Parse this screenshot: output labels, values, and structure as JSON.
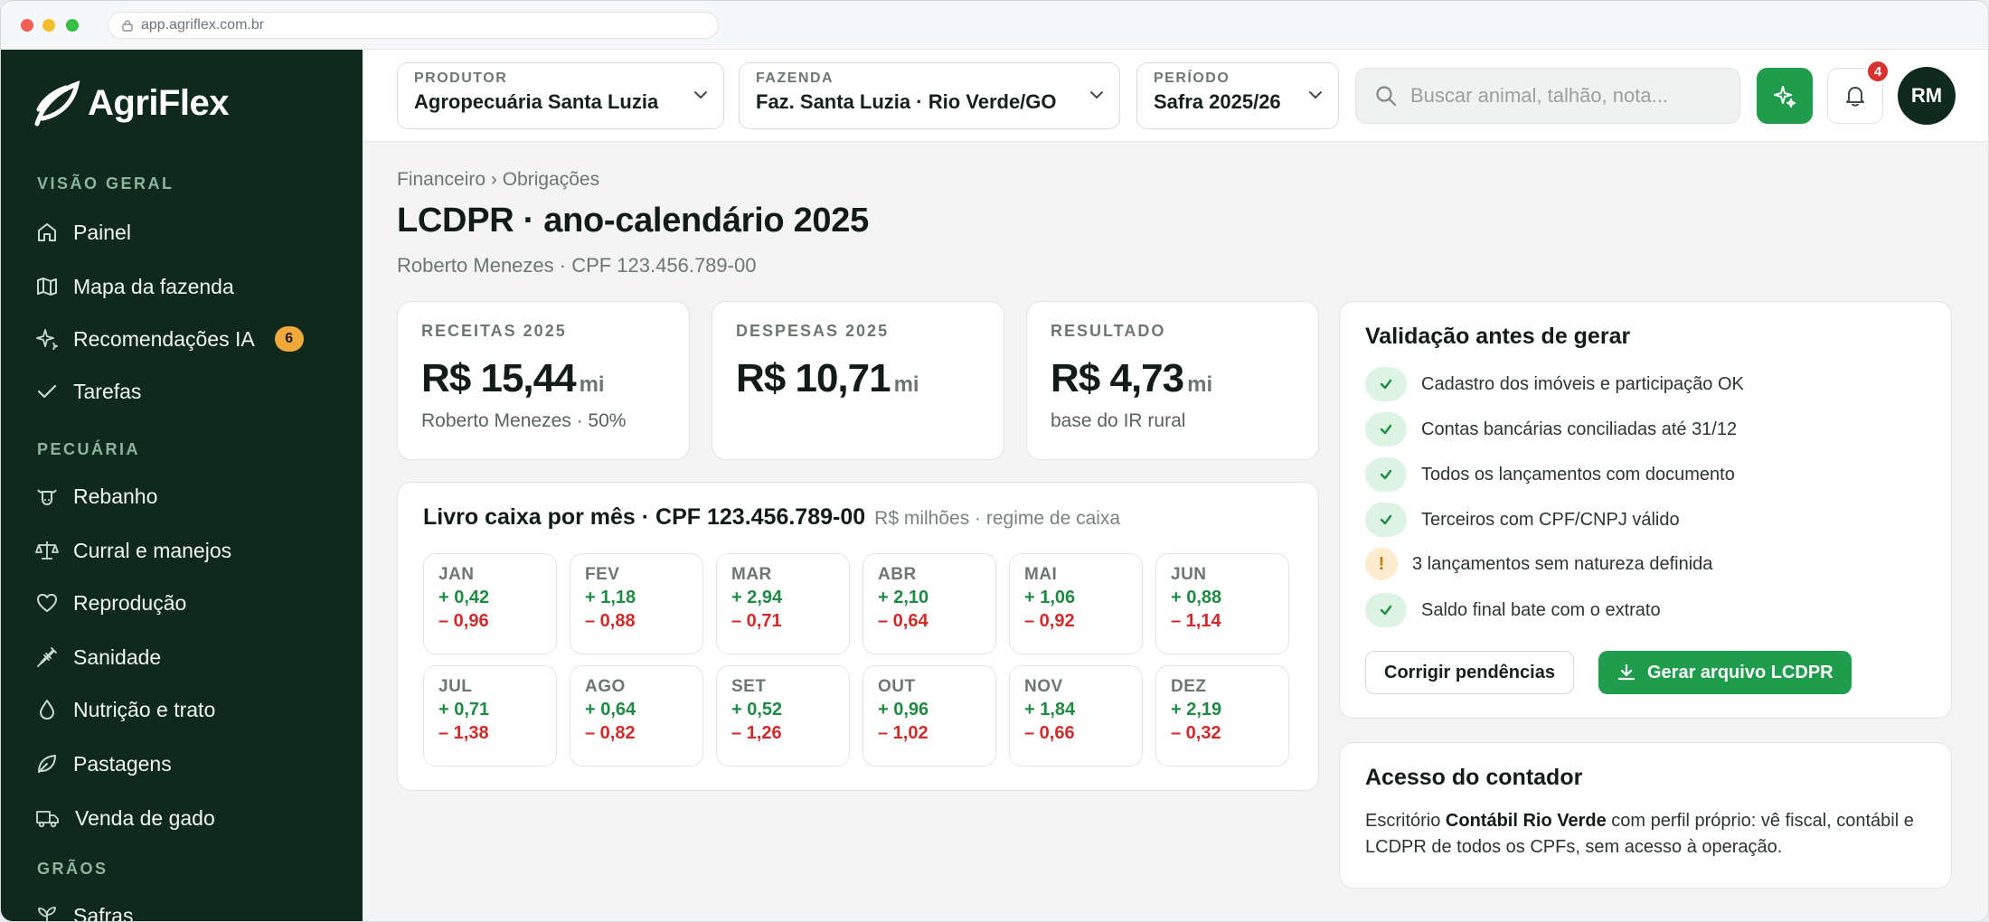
{
  "browser": {
    "url": "app.agriflex.com.br"
  },
  "brand": {
    "name": "AgriFlex"
  },
  "sidebar": {
    "sections": [
      {
        "label": "VISÃO GERAL"
      },
      {
        "label": "PECUÁRIA"
      },
      {
        "label": "GRÃOS"
      }
    ],
    "items": [
      {
        "label": "Painel",
        "icon": "home-icon"
      },
      {
        "label": "Mapa da fazenda",
        "icon": "map-icon"
      },
      {
        "label": "Recomendações IA",
        "icon": "sparkle-icon",
        "badge": "6"
      },
      {
        "label": "Tarefas",
        "icon": "check-icon"
      },
      {
        "label": "Rebanho",
        "icon": "cow-icon"
      },
      {
        "label": "Curral e manejos",
        "icon": "scale-icon"
      },
      {
        "label": "Reprodução",
        "icon": "heart-icon"
      },
      {
        "label": "Sanidade",
        "icon": "syringe-icon"
      },
      {
        "label": "Nutrição e trato",
        "icon": "drop-icon"
      },
      {
        "label": "Pastagens",
        "icon": "leaf-icon"
      },
      {
        "label": "Venda de gado",
        "icon": "truck-icon"
      },
      {
        "label": "Safras",
        "icon": "sprout-icon"
      }
    ]
  },
  "topbar": {
    "produtor": {
      "label": "PRODUTOR",
      "value": "Agropecuária Santa Luzia"
    },
    "fazenda": {
      "label": "FAZENDA",
      "value": "Faz. Santa Luzia · Rio Verde/GO"
    },
    "periodo": {
      "label": "PERÍODO",
      "value": "Safra 2025/26"
    },
    "search_placeholder": "Buscar animal, talhão, nota...",
    "notifications": "4",
    "avatar": "RM"
  },
  "page": {
    "breadcrumb": "Financeiro › Obrigações",
    "title": "LCDPR · ano-calendário 2025",
    "subtitle": "Roberto Menezes · CPF 123.456.789-00"
  },
  "kpis": [
    {
      "label": "RECEITAS 2025",
      "value": "R$ 15,44",
      "unit": "mi",
      "note": "Roberto Menezes · 50%"
    },
    {
      "label": "DESPESAS 2025",
      "value": "R$ 10,71",
      "unit": "mi",
      "note": ""
    },
    {
      "label": "RESULTADO",
      "value": "R$ 4,73",
      "unit": "mi",
      "note": "base do IR rural"
    }
  ],
  "cashbook": {
    "title": "Livro caixa por mês · CPF 123.456.789-00",
    "subtitle": "R$ milhões · regime de caixa",
    "months": [
      {
        "name": "JAN",
        "in": "+ 0,42",
        "out": "– 0,96"
      },
      {
        "name": "FEV",
        "in": "+ 1,18",
        "out": "– 0,88"
      },
      {
        "name": "MAR",
        "in": "+ 2,94",
        "out": "– 0,71"
      },
      {
        "name": "ABR",
        "in": "+ 2,10",
        "out": "– 0,64"
      },
      {
        "name": "MAI",
        "in": "+ 1,06",
        "out": "– 0,92"
      },
      {
        "name": "JUN",
        "in": "+ 0,88",
        "out": "– 1,14"
      },
      {
        "name": "JUL",
        "in": "+ 0,71",
        "out": "– 1,38"
      },
      {
        "name": "AGO",
        "in": "+ 0,64",
        "out": "– 0,82"
      },
      {
        "name": "SET",
        "in": "+ 0,52",
        "out": "– 1,26"
      },
      {
        "name": "OUT",
        "in": "+ 0,96",
        "out": "– 1,02"
      },
      {
        "name": "NOV",
        "in": "+ 1,84",
        "out": "– 0,66"
      },
      {
        "name": "DEZ",
        "in": "+ 2,19",
        "out": "– 0,32"
      }
    ]
  },
  "validation": {
    "title": "Validação antes de gerar",
    "items": [
      {
        "text": "Cadastro dos imóveis e participação OK",
        "status": "ok"
      },
      {
        "text": "Contas bancárias conciliadas até 31/12",
        "status": "ok"
      },
      {
        "text": "Todos os lançamentos com documento",
        "status": "ok"
      },
      {
        "text": "Terceiros com CPF/CNPJ válido",
        "status": "ok"
      },
      {
        "text": "3 lançamentos sem natureza definida",
        "status": "warning"
      },
      {
        "text": "Saldo final bate com o extrato",
        "status": "ok"
      }
    ],
    "fix_button": "Corrigir pendências",
    "generate_button": "Gerar arquivo LCDPR"
  },
  "accountant": {
    "title": "Acesso do contador",
    "text_pre": "Escritório ",
    "text_bold": "Contábil Rio Verde",
    "text_post": " com perfil próprio: vê fiscal, contábil e LCDPR de todos os CPFs, sem acesso à operação."
  },
  "colors": {
    "sidebar_bg": "#0f2a1c",
    "accent_green": "#1f9d4c",
    "income_green": "#1f8a44",
    "expense_red": "#d12a2a",
    "badge_orange": "#f2a93b"
  }
}
